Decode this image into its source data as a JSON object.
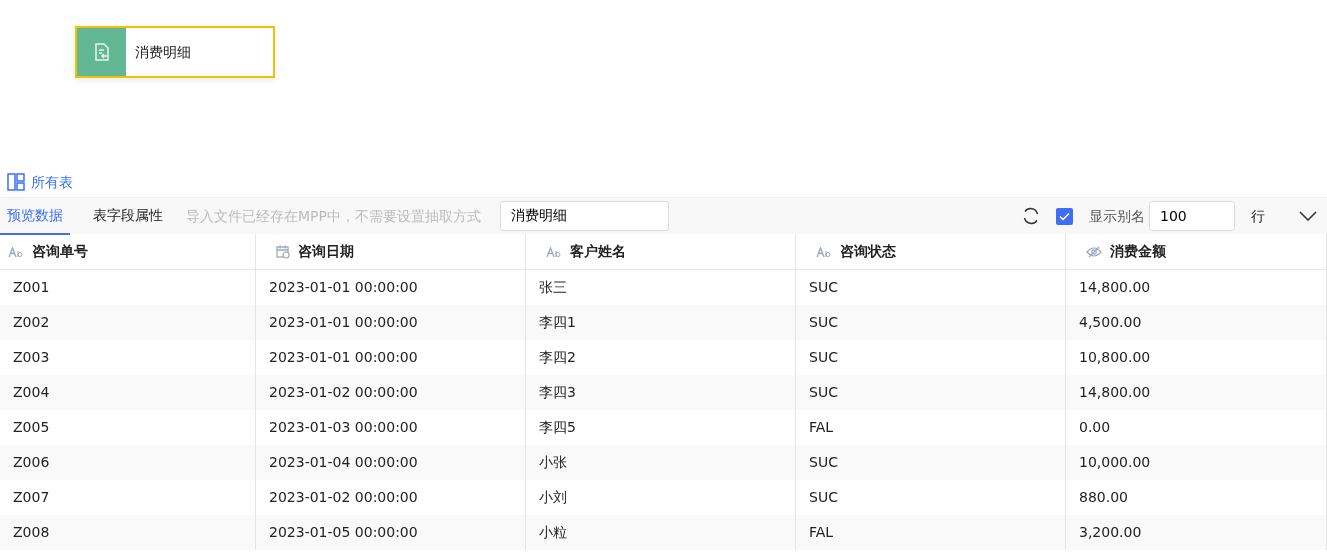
{
  "node": {
    "label": "消费明细"
  },
  "all_tables": {
    "label": "所有表"
  },
  "tabs": [
    {
      "label": "预览数据",
      "selected": true
    },
    {
      "label": "表字段属性",
      "selected": false
    }
  ],
  "hint": "导入文件已经存在MPP中，不需要设置抽取方式",
  "table_name": {
    "value": "消费明细"
  },
  "show_alias": {
    "label": "显示别名",
    "checked": true
  },
  "row_count": {
    "value": "100",
    "unit": "行"
  },
  "table": {
    "columns": [
      {
        "label": "咨询单号",
        "kind": "text"
      },
      {
        "label": "咨询日期",
        "kind": "date"
      },
      {
        "label": "客户姓名",
        "kind": "text"
      },
      {
        "label": "咨询状态",
        "kind": "text"
      },
      {
        "label": "消费金额",
        "kind": "hidden"
      }
    ],
    "rows": [
      [
        "Z001",
        "2023-01-01 00:00:00",
        "张三",
        "SUC",
        "14,800.00"
      ],
      [
        "Z002",
        "2023-01-01 00:00:00",
        "李四1",
        "SUC",
        "4,500.00"
      ],
      [
        "Z003",
        "2023-01-01 00:00:00",
        "李四2",
        "SUC",
        "10,800.00"
      ],
      [
        "Z004",
        "2023-01-02 00:00:00",
        "李四3",
        "SUC",
        "14,800.00"
      ],
      [
        "Z005",
        "2023-01-03 00:00:00",
        "李四5",
        "FAL",
        "0.00"
      ],
      [
        "Z006",
        "2023-01-04 00:00:00",
        "小张",
        "SUC",
        "10,000.00"
      ],
      [
        "Z007",
        "2023-01-02 00:00:00",
        "小刘",
        "SUC",
        "880.00"
      ],
      [
        "Z008",
        "2023-01-05 00:00:00",
        "小粒",
        "FAL",
        "3,200.00"
      ]
    ]
  }
}
